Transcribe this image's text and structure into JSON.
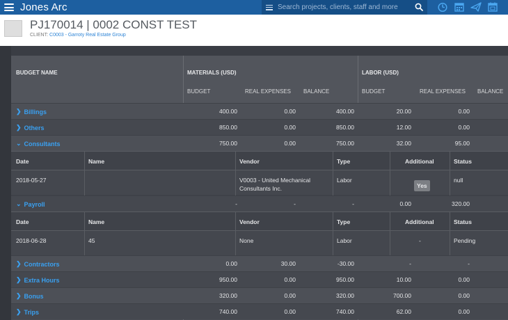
{
  "app": {
    "brand": "Jones Arc",
    "search_placeholder": "Search projects, clients, staff and more"
  },
  "project": {
    "title": "PJ170014 | 0002 CONST TEST",
    "client_label": "CLIENT:",
    "client_link": "C0003 - Garroty Real Estate Group"
  },
  "table": {
    "headers": {
      "budget_name": "BUDGET NAME",
      "materials": "MATERIALS (USD)",
      "labor": "LABOR (USD)",
      "budget": "BUDGET",
      "real_expenses": "REAL EXPENSES",
      "balance": "BALANCE"
    },
    "rows": [
      {
        "name": "Billings",
        "m_budget": "400.00",
        "m_real": "0.00",
        "m_balance": "400.00",
        "l_budget": "20.00",
        "l_real": "0.00"
      },
      {
        "name": "Others",
        "m_budget": "850.00",
        "m_real": "0.00",
        "m_balance": "850.00",
        "l_budget": "12.00",
        "l_real": "0.00"
      },
      {
        "name": "Consultants",
        "m_budget": "750.00",
        "m_real": "0.00",
        "m_balance": "750.00",
        "l_budget": "32.00",
        "l_real": "95.00"
      },
      {
        "name": "Payroll",
        "m_budget": "-",
        "m_real": "-",
        "m_balance": "-",
        "l_budget": "0.00",
        "l_real": "320.00"
      },
      {
        "name": "Contractors",
        "m_budget": "0.00",
        "m_real": "30.00",
        "m_balance": "-30.00",
        "l_budget": "-",
        "l_real": "-"
      },
      {
        "name": "Extra Hours",
        "m_budget": "950.00",
        "m_real": "0.00",
        "m_balance": "950.00",
        "l_budget": "10.00",
        "l_real": "0.00"
      },
      {
        "name": "Bonus",
        "m_budget": "320.00",
        "m_real": "0.00",
        "m_balance": "320.00",
        "l_budget": "700.00",
        "l_real": "0.00"
      },
      {
        "name": "Trips",
        "m_budget": "740.00",
        "m_real": "0.00",
        "m_balance": "740.00",
        "l_budget": "62.00",
        "l_real": "0.00"
      }
    ],
    "detail_headers": {
      "date": "Date",
      "name": "Name",
      "vendor": "Vendor",
      "type": "Type",
      "additional": "Additional",
      "status": "Status"
    },
    "consultants_detail": {
      "date": "2018-05-27",
      "name": "",
      "vendor": "V0003 - United Mechanical Consultants Inc.",
      "type": "Labor",
      "additional": "Yes",
      "status": "null"
    },
    "payroll_detail": {
      "date": "2018-06-28",
      "name": "45",
      "vendor": "None",
      "type": "Labor",
      "additional": "-",
      "status": "Pending"
    }
  }
}
